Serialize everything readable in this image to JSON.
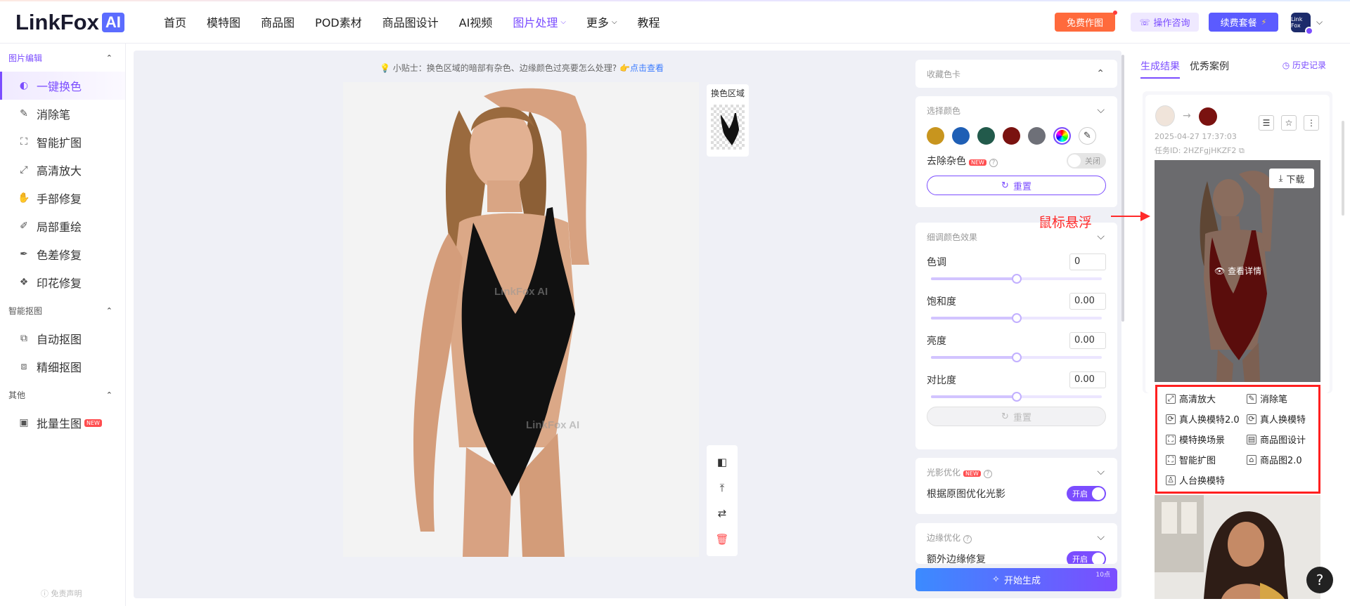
{
  "header": {
    "logo_text": "LinkFox",
    "logo_ai": "AI",
    "nav": [
      {
        "label": "首页"
      },
      {
        "label": "模特图"
      },
      {
        "label": "商品图"
      },
      {
        "label": "POD素材"
      },
      {
        "label": "商品图设计"
      },
      {
        "label": "AI视频"
      },
      {
        "label": "图片处理",
        "active": true,
        "has_dropdown": true
      },
      {
        "label": "更多",
        "has_dropdown": true
      },
      {
        "label": "教程"
      }
    ],
    "free_btn": "免费作图",
    "consult_btn": "操作咨询",
    "renew_btn": "续费套餐",
    "avatar_text": "Link Fox"
  },
  "sidebar": {
    "groups": [
      {
        "title": "图片编辑",
        "items": [
          {
            "label": "一键换色",
            "icon": "color-swap-icon",
            "active": true
          },
          {
            "label": "消除笔",
            "icon": "eraser-icon"
          },
          {
            "label": "智能扩图",
            "icon": "expand-icon"
          },
          {
            "label": "高清放大",
            "icon": "upscale-icon"
          },
          {
            "label": "手部修复",
            "icon": "hand-icon"
          },
          {
            "label": "局部重绘",
            "icon": "brush-icon"
          },
          {
            "label": "色差修复",
            "icon": "palette-icon"
          },
          {
            "label": "印花修复",
            "icon": "print-icon"
          }
        ]
      },
      {
        "title": "智能抠图",
        "items": [
          {
            "label": "自动抠图",
            "icon": "auto-cutout-icon"
          },
          {
            "label": "精细抠图",
            "icon": "fine-cutout-icon"
          }
        ]
      },
      {
        "title": "其他",
        "items": [
          {
            "label": "批量生图",
            "icon": "batch-image-icon",
            "badge": "NEW"
          }
        ]
      }
    ],
    "footer": "免责声明"
  },
  "workarea": {
    "tip_text": "小贴士：换色区域的暗部有杂色、边缘颜色过亮要怎么处理?",
    "tip_link": "点击查看",
    "watermark": "LinkFox AI",
    "mask_label": "换色区域"
  },
  "panel": {
    "collect_title": "收藏色卡",
    "select_title": "选择颜色",
    "swatches": [
      "#c8951e",
      "#1f5fb5",
      "#225a4b",
      "#7a1210",
      "#6e7078"
    ],
    "remove_noise_label": "去除杂色",
    "remove_noise_badge": "NEW",
    "remove_noise_state": "关闭",
    "reset_label": "重置",
    "fine_title": "细调颜色效果",
    "fine_controls": [
      {
        "label": "色调",
        "value": "0",
        "level": 0.5
      },
      {
        "label": "饱和度",
        "value": "0.00",
        "level": 0.5
      },
      {
        "label": "亮度",
        "value": "0.00",
        "level": 0.5
      },
      {
        "label": "对比度",
        "value": "0.00",
        "level": 0.5
      }
    ],
    "fine_reset_label": "重置",
    "light_title": "光影优化",
    "light_badge": "NEW",
    "light_row_label": "根据原图优化光影",
    "light_state": "开启",
    "edge_title": "边缘优化",
    "edge_row_label": "额外边缘修复",
    "edge_state": "开启",
    "generate_label": "开始生成",
    "generate_cost": "10点"
  },
  "results": {
    "tabs": [
      {
        "label": "生成结果",
        "active": true
      },
      {
        "label": "优秀案例"
      }
    ],
    "history": "历史记录",
    "card": {
      "date": "2025-04-27 17:37:03",
      "task": "任务ID: 2HZFgjHKZF2",
      "swatch": "#7a1210",
      "download": "下载",
      "view_detail": "查看详情"
    },
    "hover_annotation": "鼠标悬浮",
    "menu": [
      {
        "label": "高清放大",
        "icon": "upscale-icon"
      },
      {
        "label": "消除笔",
        "icon": "eraser-icon"
      },
      {
        "label": "真人换模特2.0",
        "icon": "swap-model-icon"
      },
      {
        "label": "真人换模特",
        "icon": "swap-model-icon"
      },
      {
        "label": "模特换场景",
        "icon": "scene-icon"
      },
      {
        "label": "商品图设计",
        "icon": "layout-icon"
      },
      {
        "label": "智能扩图",
        "icon": "expand-icon"
      },
      {
        "label": "商品图2.0",
        "icon": "bag-icon"
      },
      {
        "label": "人台换模特",
        "icon": "mannequin-icon"
      }
    ]
  }
}
